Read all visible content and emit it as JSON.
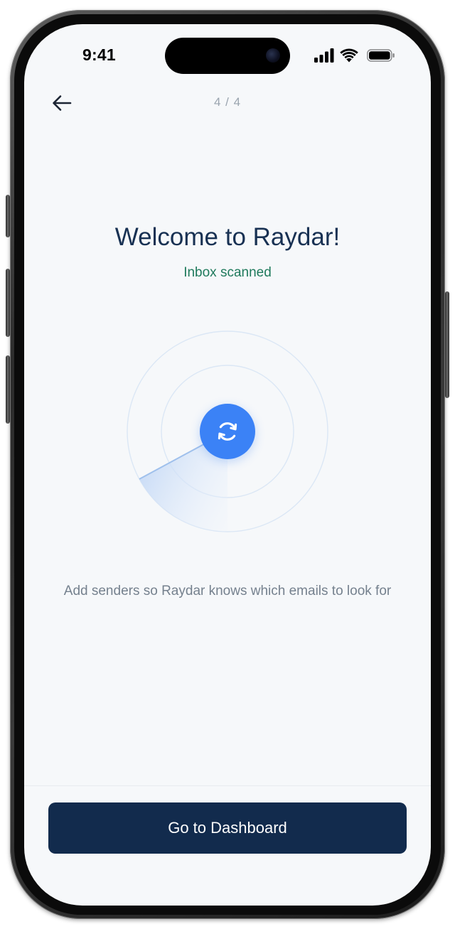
{
  "status_bar": {
    "time": "9:41",
    "icons": [
      "cellular-signal-icon",
      "wifi-icon",
      "battery-icon"
    ]
  },
  "nav": {
    "back_icon": "arrow-left-icon",
    "step": "4 / 4"
  },
  "content": {
    "title": "Welcome to Raydar!",
    "subtitle": "Inbox scanned",
    "center_icon": "sync-icon",
    "description": "Add senders so Raydar knows which emails to look for"
  },
  "footer": {
    "primary_label": "Go to Dashboard"
  },
  "colors": {
    "background": "#f6f8fa",
    "title": "#183153",
    "success": "#1f7a5c",
    "accent": "#3b82f6",
    "primary_button": "#122b4d",
    "muted_text": "#75818e"
  }
}
